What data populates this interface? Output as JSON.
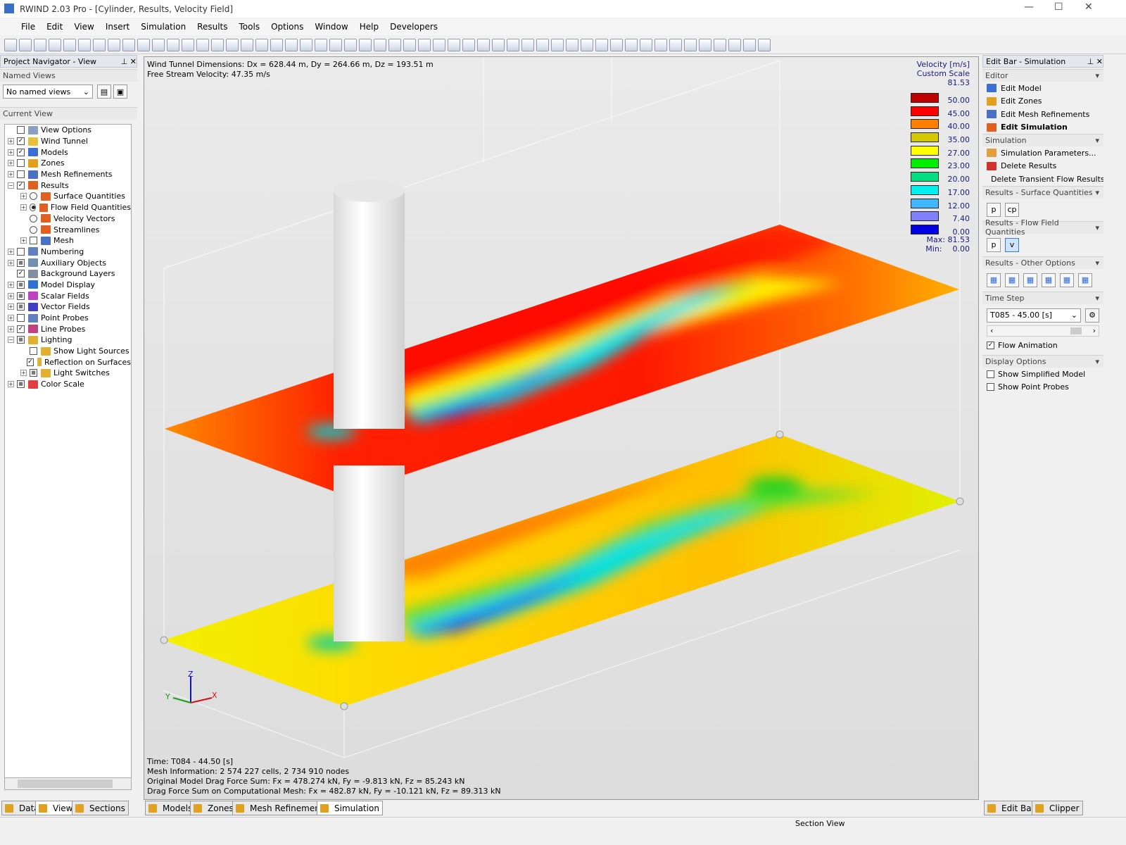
{
  "window": {
    "title": "RWIND 2.03 Pro - [Cylinder, Results, Velocity Field]"
  },
  "menu": [
    "File",
    "Edit",
    "View",
    "Insert",
    "Simulation",
    "Results",
    "Tools",
    "Options",
    "Window",
    "Help",
    "Developers"
  ],
  "left": {
    "title": "Project Navigator - View",
    "named_views_label": "Named Views",
    "named_views_value": "No named views",
    "current_view_label": "Current View",
    "tree": [
      {
        "label": "View Options",
        "lvl": 0,
        "pm": "",
        "chk": "box",
        "state": "",
        "color": "#8aa0c0"
      },
      {
        "label": "Wind Tunnel",
        "lvl": 0,
        "pm": "+",
        "chk": "box",
        "state": "✓",
        "color": "#e8c040"
      },
      {
        "label": "Models",
        "lvl": 0,
        "pm": "+",
        "chk": "box",
        "state": "✓",
        "color": "#3b6fd4"
      },
      {
        "label": "Zones",
        "lvl": 0,
        "pm": "+",
        "chk": "box",
        "state": "",
        "color": "#e0a020"
      },
      {
        "label": "Mesh Refinements",
        "lvl": 0,
        "pm": "+",
        "chk": "box",
        "state": "",
        "color": "#4a70c0"
      },
      {
        "label": "Results",
        "lvl": 0,
        "pm": "−",
        "chk": "box",
        "state": "✓",
        "color": "#e06020"
      },
      {
        "label": "Surface Quantities",
        "lvl": 1,
        "pm": "+",
        "chk": "radio",
        "state": "",
        "color": "#e06020"
      },
      {
        "label": "Flow Field Quantities",
        "lvl": 1,
        "pm": "+",
        "chk": "radio",
        "state": "on",
        "color": "#e06020"
      },
      {
        "label": "Velocity Vectors",
        "lvl": 1,
        "pm": "",
        "chk": "radio",
        "state": "",
        "color": "#e06020"
      },
      {
        "label": "Streamlines",
        "lvl": 1,
        "pm": "",
        "chk": "radio",
        "state": "",
        "color": "#e06020"
      },
      {
        "label": "Mesh",
        "lvl": 1,
        "pm": "+",
        "chk": "box",
        "state": "",
        "color": "#4a70c0"
      },
      {
        "label": "Numbering",
        "lvl": 0,
        "pm": "+",
        "chk": "box",
        "state": "",
        "color": "#6080c0"
      },
      {
        "label": "Auxiliary Objects",
        "lvl": 0,
        "pm": "+",
        "chk": "box",
        "state": "■",
        "color": "#7090b0"
      },
      {
        "label": "Background Layers",
        "lvl": 0,
        "pm": "",
        "chk": "box",
        "state": "✓",
        "color": "#8090a0"
      },
      {
        "label": "Model Display",
        "lvl": 0,
        "pm": "+",
        "chk": "box",
        "state": "■",
        "color": "#3070d0"
      },
      {
        "label": "Scalar Fields",
        "lvl": 0,
        "pm": "+",
        "chk": "box",
        "state": "■",
        "color": "#c040c0"
      },
      {
        "label": "Vector Fields",
        "lvl": 0,
        "pm": "+",
        "chk": "box",
        "state": "■",
        "color": "#4040c0"
      },
      {
        "label": "Point Probes",
        "lvl": 0,
        "pm": "+",
        "chk": "box",
        "state": "",
        "color": "#6080c0"
      },
      {
        "label": "Line Probes",
        "lvl": 0,
        "pm": "+",
        "chk": "box",
        "state": "✓",
        "color": "#c04080"
      },
      {
        "label": "Lighting",
        "lvl": 0,
        "pm": "−",
        "chk": "box",
        "state": "■",
        "color": "#e0b030"
      },
      {
        "label": "Show Light Sources",
        "lvl": 1,
        "pm": "",
        "chk": "box",
        "state": "",
        "color": "#e0b030"
      },
      {
        "label": "Reflection on Surfaces",
        "lvl": 1,
        "pm": "",
        "chk": "box",
        "state": "✓",
        "color": "#e0b030"
      },
      {
        "label": "Light Switches",
        "lvl": 1,
        "pm": "+",
        "chk": "box",
        "state": "■",
        "color": "#e0b030"
      },
      {
        "label": "Color Scale",
        "lvl": 0,
        "pm": "+",
        "chk": "box",
        "state": "■",
        "color": "#e04040"
      }
    ]
  },
  "viewport": {
    "info_top": [
      "Wind Tunnel Dimensions: Dx = 628.44 m, Dy = 264.66 m, Dz = 193.51 m",
      "Free Stream Velocity: 47.35 m/s"
    ],
    "info_bottom": [
      "Time: T084 - 44.50 [s]",
      "Mesh Information: 2 574 227 cells, 2 734 910 nodes",
      "Original Model Drag Force Sum: Fx = 478.274 kN, Fy = -9.813 kN, Fz = 85.243 kN",
      "Drag Force Sum on Computational Mesh: Fx = 482.87 kN, Fy = -10.121 kN, Fz = 89.313 kN"
    ],
    "axes": {
      "x": "X",
      "y": "Y",
      "z": "Z"
    }
  },
  "legend": {
    "title": "Velocity [m/s]",
    "subtitle": "Custom Scale",
    "top_value": "81.53",
    "bands": [
      {
        "color": "#c00000",
        "value": "50.00"
      },
      {
        "color": "#ff0000",
        "value": "45.00"
      },
      {
        "color": "#ff8000",
        "value": "40.00"
      },
      {
        "color": "#d4c800",
        "value": "35.00"
      },
      {
        "color": "#ffff00",
        "value": "27.00"
      },
      {
        "color": "#00ee00",
        "value": "23.00"
      },
      {
        "color": "#00e080",
        "value": "20.00"
      },
      {
        "color": "#00f0f0",
        "value": "17.00"
      },
      {
        "color": "#40b8ff",
        "value": "12.00"
      },
      {
        "color": "#8080ff",
        "value": "7.40"
      },
      {
        "color": "#0000e0",
        "value": "0.00"
      }
    ],
    "max_label": "Max:",
    "max": "81.53",
    "min_label": "Min:",
    "min": "0.00"
  },
  "right": {
    "title": "Edit Bar - Simulation",
    "editor_label": "Editor",
    "editor": [
      "Edit Model",
      "Edit Zones",
      "Edit Mesh Refinements",
      "Edit Simulation"
    ],
    "simulation_label": "Simulation",
    "simulation": [
      "Simulation Parameters...",
      "Delete Results",
      "Delete Transient Flow Results..."
    ],
    "surface_label": "Results - Surface Quantities",
    "surface_btns": [
      "p",
      "cp"
    ],
    "flow_label": "Results - Flow Field Quantities",
    "flow_btns": [
      "p",
      "v"
    ],
    "other_label": "Results - Other Options",
    "timestep_label": "Time Step",
    "timestep_value": "T085 - 45.00 [s]",
    "flow_animation": "Flow Animation",
    "display_label": "Display Options",
    "display": [
      "Show Simplified Model",
      "Show Point Probes"
    ]
  },
  "bottom_tabs_left": [
    "Data",
    "View",
    "Sections"
  ],
  "bottom_tabs_mid": [
    "Models",
    "Zones",
    "Mesh Refinements",
    "Simulation"
  ],
  "bottom_tabs_right": [
    "Edit Bar",
    "Clipper"
  ],
  "status": {
    "section_view": "Section View"
  }
}
